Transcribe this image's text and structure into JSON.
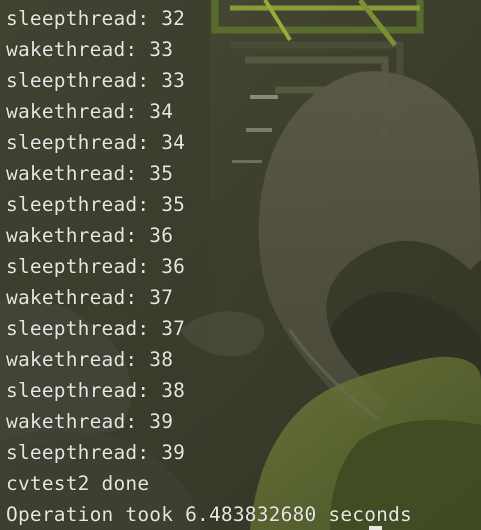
{
  "terminal": {
    "lines": [
      "sleepthread: 32",
      "wakethread: 33",
      "sleepthread: 33",
      "wakethread: 34",
      "sleepthread: 34",
      "wakethread: 35",
      "sleepthread: 35",
      "wakethread: 36",
      "sleepthread: 36",
      "wakethread: 37",
      "sleepthread: 37",
      "wakethread: 38",
      "sleepthread: 38",
      "wakethread: 39",
      "sleepthread: 39",
      "cvtest2 done",
      "Operation took 6.483832680 seconds"
    ],
    "text_color": "#e6e6e2",
    "background_color": "#3a3c2a"
  }
}
